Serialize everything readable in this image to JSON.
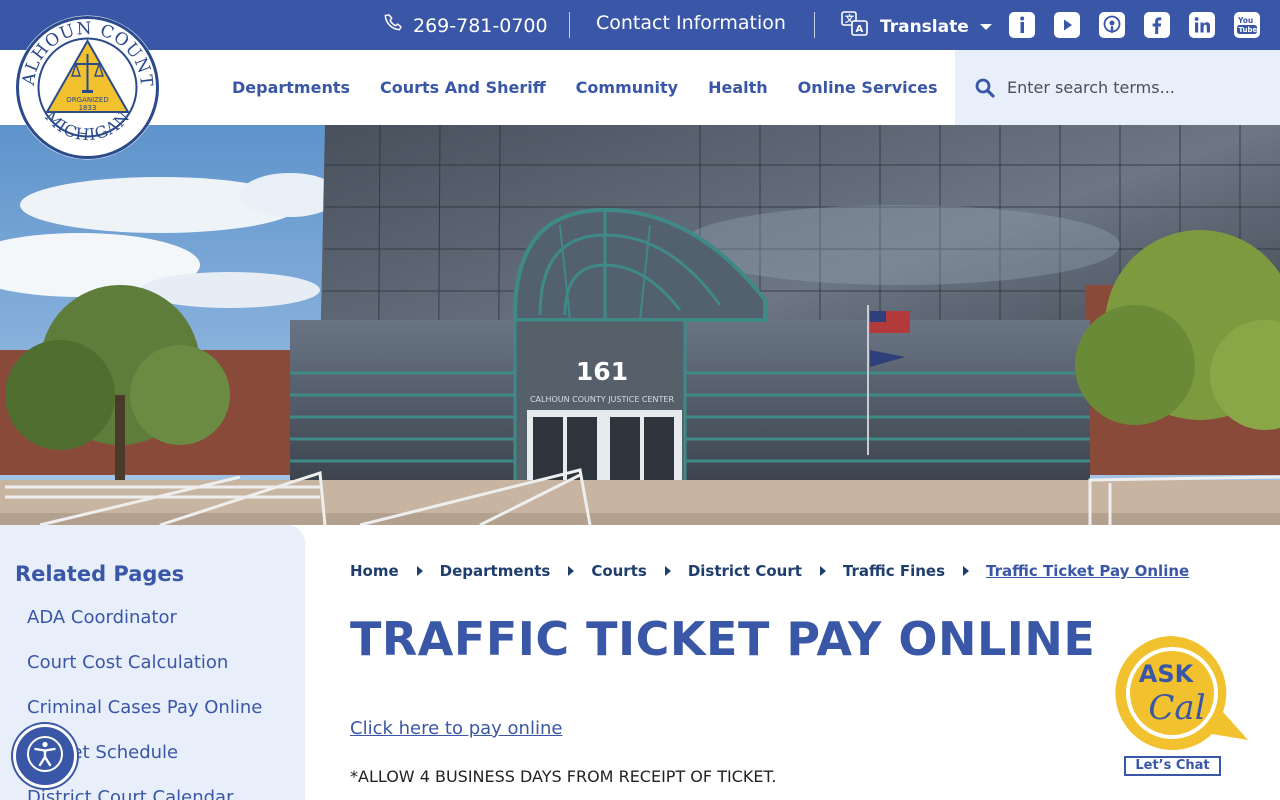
{
  "topbar": {
    "phone": "269-781-0700",
    "contact_label": "Contact Information",
    "translate_label": "Translate",
    "social": [
      "info-icon",
      "youtube-icon",
      "podcast-icon",
      "facebook-icon",
      "linkedin-icon",
      "youtube-logo-icon"
    ]
  },
  "logo": {
    "top_text": "CALHOUN COUNTY",
    "bottom_text": "MICHIGAN",
    "organized": "ORGANIZED",
    "year": "1833"
  },
  "nav": {
    "items": [
      "Departments",
      "Courts And Sheriff",
      "Community",
      "Health",
      "Online Services"
    ]
  },
  "search": {
    "placeholder": "Enter search terms..."
  },
  "hero": {
    "building_number": "161",
    "sign_text": "CALHOUN COUNTY JUSTICE CENTER"
  },
  "sidebar": {
    "title": "Related Pages",
    "items": [
      "ADA Coordinator",
      "Court Cost Calculation",
      "Criminal Cases Pay Online",
      "Docket Schedule",
      "District Court Calendar"
    ]
  },
  "breadcrumb": {
    "items": [
      "Home",
      "Departments",
      "Courts",
      "District Court",
      "Traffic Fines"
    ],
    "current": "Traffic Ticket Pay Online"
  },
  "main": {
    "title": "TRAFFIC TICKET PAY ONLINE",
    "pay_link": "Click here to pay online",
    "note": "*ALLOW 4 BUSINESS DAYS FROM RECEIPT OF TICKET."
  },
  "askcal": {
    "ask": "ASK",
    "name": "Cal",
    "chat_label": "Let’s Chat"
  },
  "colors": {
    "primary": "#3a57a7",
    "light_bg": "#e8effb",
    "gold": "#f2c12e",
    "dark_blue": "#1f3e6e"
  }
}
